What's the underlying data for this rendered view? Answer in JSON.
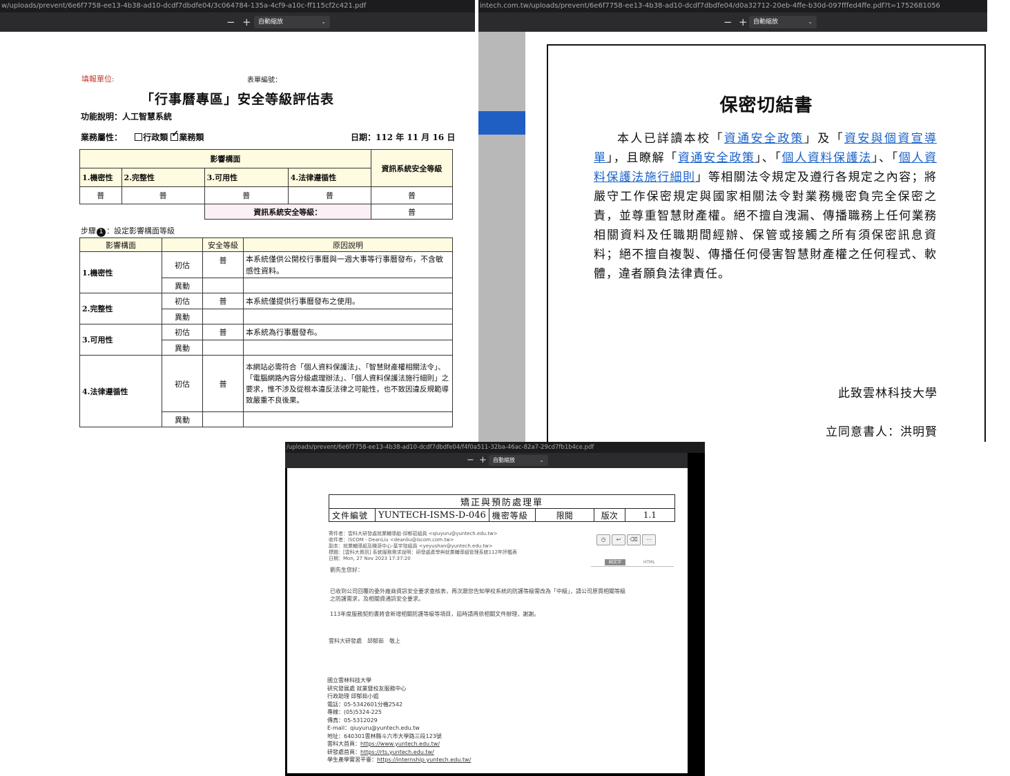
{
  "viewer_form": {
    "url": "w/uploads/prevent/6e6f7758-ee13-4b38-ad10-dcdf7dbdfe04/3c064784-135a-4cf9-a10c-ff115cf2c421.pdf",
    "zoom_label": "自動縮放",
    "zoom_out": "−",
    "zoom_in": "+",
    "page": {
      "fill_unit_label": "填報單位:",
      "form_number_label": "表單編號：",
      "title": "「行事曆專區」安全等級評估表",
      "function_desc": "功能說明：人工智慧系統",
      "business_attr_label": "業務屬性：",
      "opt_admin": "行政類",
      "opt_business": "業務類",
      "date": "日期：112 年 11 月 16 日",
      "impact_header": "影響構面",
      "level_header": "資訊系統安全等級",
      "cols": [
        "1.機密性",
        "2.完整性",
        "3.可用性",
        "4.法律遵循性"
      ],
      "values": [
        "普",
        "普",
        "普",
        "普"
      ],
      "sys_level_value": "普",
      "sys_level_label": "資訊系統安全等級：",
      "sys_level_result": "普",
      "step_prefix": "步驟",
      "step_num": "1",
      "step_text": "：設定影響構面等級",
      "detail_headers": [
        "影響構面",
        "安全等級",
        "原因說明"
      ],
      "rows": [
        {
          "name": "1.機密性",
          "initial": "初估",
          "level": "普",
          "reason": "本系統僅供公開校行事曆與一週大事等行事曆發布，不含敏感性資料。",
          "change": "異動"
        },
        {
          "name": "2.完整性",
          "initial": "初估",
          "level": "普",
          "reason": "本系統僅提供行事曆發布之使用。",
          "change": "異動"
        },
        {
          "name": "3.可用性",
          "initial": "初估",
          "level": "普",
          "reason": "本系統為行事曆發布。",
          "change": "異動"
        },
        {
          "name": "4.法律遵循性",
          "initial": "初估",
          "level": "普",
          "reason": "本網站必需符合「個人資料保護法」、「智慧財產權相關法令」、「電腦網路內容分級處理辦法」、「個人資料保護法施行細則」之要求，惟不涉及從根本違反法律之可能性，也不致因違反規範導致嚴重不良後果。",
          "change": "異動"
        }
      ]
    }
  },
  "viewer_pledge": {
    "url": "intech.com.tw/uploads/prevent/6e6f7758-ee13-4b38-ad10-dcdf7dbdfe04/d0a32712-20eb-4ffe-b30d-097fffed4ffe.pdf?t=1752681056",
    "zoom_label": "自動縮放",
    "zoom_out": "−",
    "zoom_in": "+",
    "page": {
      "title": "保密切結書",
      "p_intro": "本人已詳讀本校「",
      "link1": "資通安全政策",
      "p_mid1": "」及「",
      "link2": "資安與個資宣導單",
      "p_mid2": "」，且瞭解「",
      "link3": "資通安全政策",
      "p_mid3": "」、「",
      "link4": "個人資料保護法",
      "p_mid4": "」、「",
      "link5": "個人資料保護法施行細則",
      "p_rest": "」等相關法令規定及遵行各規定之內容；將嚴守工作保密規定與國家相關法令對業務機密負完全保密之責，並尊重智慧財產權。絕不擅自洩漏、傳播職務上任何業務相關資料及任職期間經辦、保管或接觸之所有須保密訊息資料；絕不擅自複製、傳播任何侵害智慧財產權之任何程式、軟體，違者願負法律責任。",
      "to_line": "此致雲林科技大學",
      "signer_line": "立同意書人：洪明賢"
    }
  },
  "viewer_email": {
    "url": "/uploads/prevent/6e6f7758-ee13-4b38-ad10-dcdf7dbdfe04/f4f0a511-32ba-46ac-82a7-29cd7fb1b4ce.pdf",
    "zoom_label": "自動縮放",
    "zoom_out": "−",
    "zoom_in": "+",
    "page": {
      "doc_title": "矯正與預防處理單",
      "doc_no_label": "文件編號",
      "doc_no": "YUNTECH-ISMS-D-046",
      "secret_label": "機密等級",
      "secret_value": "限閱",
      "version_label": "版次",
      "version": "1.1",
      "hdr_from": "寄件者：雲科大研發處就業輔導組-邱郁茹組員 <qiuyuru@yuntech.edu.tw>",
      "hdr_to": "收件者：iSCOM - DeanLiu <deanliu@iscom.com.tw>",
      "hdr_cc": "副本：就業輔導組及職涯中心-葉宇瑄組員 <yeyushan@yuntech.edu.tw>",
      "hdr_subject": "標題：[雲科大資訊] 系統服務需求說明：研發處產學與就業輔導組管理系統112年評鑑表",
      "hdr_date": "日期：Mon, 27 Nov 2023 17:37:20",
      "tab_plain": "純文字",
      "tab_html": "HTML",
      "greeting": "劉先生您好：",
      "para1": "已收到公司回覆的委外廠商資訊安全要求查核表，再次跟您告知學校系統的防護等級需改為「中級」，請公司原貫相關等級之防護需求，及相關資通訊安全要求。",
      "para2": "113年度服務契約書將會新增相關防護等級等項目，屆時請再依相關文件辦理，謝謝。",
      "closing": "雲科大研發處　邱郁茹　敬上",
      "sig": [
        "國立雲林科技大學",
        "研究發展處 就業暨校友服務中心",
        "行政助理 邱郁茹小姐",
        "電話：05-5342601分機2542",
        "專線：(05)5324-225",
        "傳真：05-5312029",
        "E-mail：qiuyuru@yuntech.edu.tw",
        "地址：640301雲林縣斗六市大學路三段123號"
      ],
      "links": [
        {
          "label": "雲科大首頁：",
          "url": "https://www.yuntech.edu.tw/"
        },
        {
          "label": "研發處首頁：",
          "url": "https://rts.yuntech.edu.tw/"
        },
        {
          "label": "學生產學實習平臺：",
          "url": "https://internship.yuntech.edu.tw/"
        }
      ]
    }
  }
}
